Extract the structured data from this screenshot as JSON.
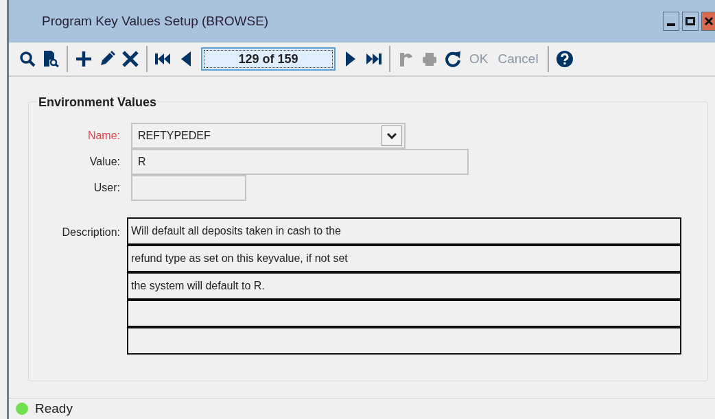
{
  "window": {
    "title": "Program Key Values Setup (BROWSE)"
  },
  "toolbar": [
    {
      "kind": "find",
      "disabled": false
    },
    {
      "kind": "browse",
      "disabled": false
    },
    {
      "kind": "separator"
    },
    {
      "kind": "add",
      "disabled": false
    },
    {
      "kind": "edit",
      "disabled": false
    },
    {
      "kind": "delete",
      "disabled": false
    },
    {
      "kind": "separator"
    },
    {
      "kind": "first",
      "disabled": false
    },
    {
      "kind": "prev",
      "disabled": false
    },
    {
      "kind": "record",
      "text": "129 of 159"
    },
    {
      "kind": "next",
      "disabled": false
    },
    {
      "kind": "last",
      "disabled": false
    },
    {
      "kind": "separator"
    },
    {
      "kind": "undo",
      "disabled": true
    },
    {
      "kind": "print",
      "disabled": true
    },
    {
      "kind": "refresh",
      "disabled": false
    },
    {
      "kind": "text",
      "text": "OK",
      "disabled": true
    },
    {
      "kind": "text",
      "text": "Cancel",
      "disabled": true
    },
    {
      "kind": "separator"
    },
    {
      "kind": "help",
      "disabled": false
    }
  ],
  "group": {
    "title": "Environment Values",
    "fields": [
      {
        "label": "Name:",
        "value": "REFTYPEDEF",
        "required": true,
        "kind": "dropdown"
      },
      {
        "label": "Value:",
        "value": "R",
        "required": false,
        "kind": "text"
      },
      {
        "label": "User:",
        "required": false,
        "kind": "short"
      }
    ],
    "description": {
      "label": "Description:",
      "lines": [
        {
          "kind": "text",
          "text": "Will default all deposits taken in cash to the"
        },
        {
          "kind": "text",
          "text": "refund type as set on this keyvalue, if not set"
        },
        {
          "kind": "text",
          "text": "the system will default to R."
        },
        {
          "kind": "blank"
        },
        {
          "kind": "blank"
        }
      ]
    }
  },
  "status_bar": {
    "text": "Ready"
  }
}
